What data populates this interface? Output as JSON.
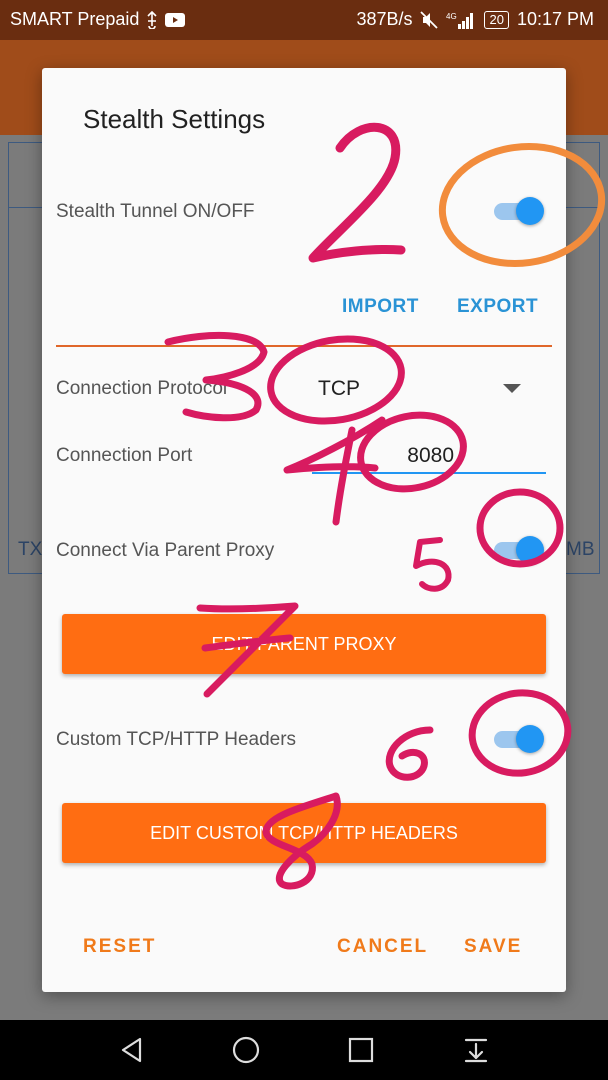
{
  "status_bar": {
    "carrier": "SMART Prepaid",
    "net_speed": "387B/s",
    "network": "4G",
    "battery": "20",
    "time": "10:17 PM"
  },
  "background": {
    "tx_label": "TX",
    "mb_label": "MB"
  },
  "dialog": {
    "title": "Stealth Settings",
    "stealth_tunnel": {
      "label": "Stealth Tunnel ON/OFF",
      "on": true
    },
    "import_label": "IMPORT",
    "export_label": "EXPORT",
    "protocol": {
      "label": "Connection Protocol",
      "value": "TCP"
    },
    "port": {
      "label": "Connection Port",
      "value": "8080"
    },
    "parent_proxy": {
      "label": "Connect Via Parent Proxy",
      "on": true
    },
    "edit_parent_proxy_label": "EDIT PARENT PROXY",
    "custom_headers": {
      "label": "Custom TCP/HTTP Headers",
      "on": true
    },
    "edit_custom_headers_label": "EDIT CUSTOM TCP/HTTP HEADERS",
    "reset_label": "RESET",
    "cancel_label": "CANCEL",
    "save_label": "SAVE"
  },
  "annotations": {
    "numbers": [
      "2",
      "3",
      "4",
      "5",
      "6",
      "7",
      "8"
    ]
  },
  "colors": {
    "accent_orange": "#ff6d12",
    "switch_blue": "#2196f3",
    "link_blue": "#2a93d5",
    "annotation_pink": "#d81b60",
    "annotation_orange": "#f28c3c"
  }
}
